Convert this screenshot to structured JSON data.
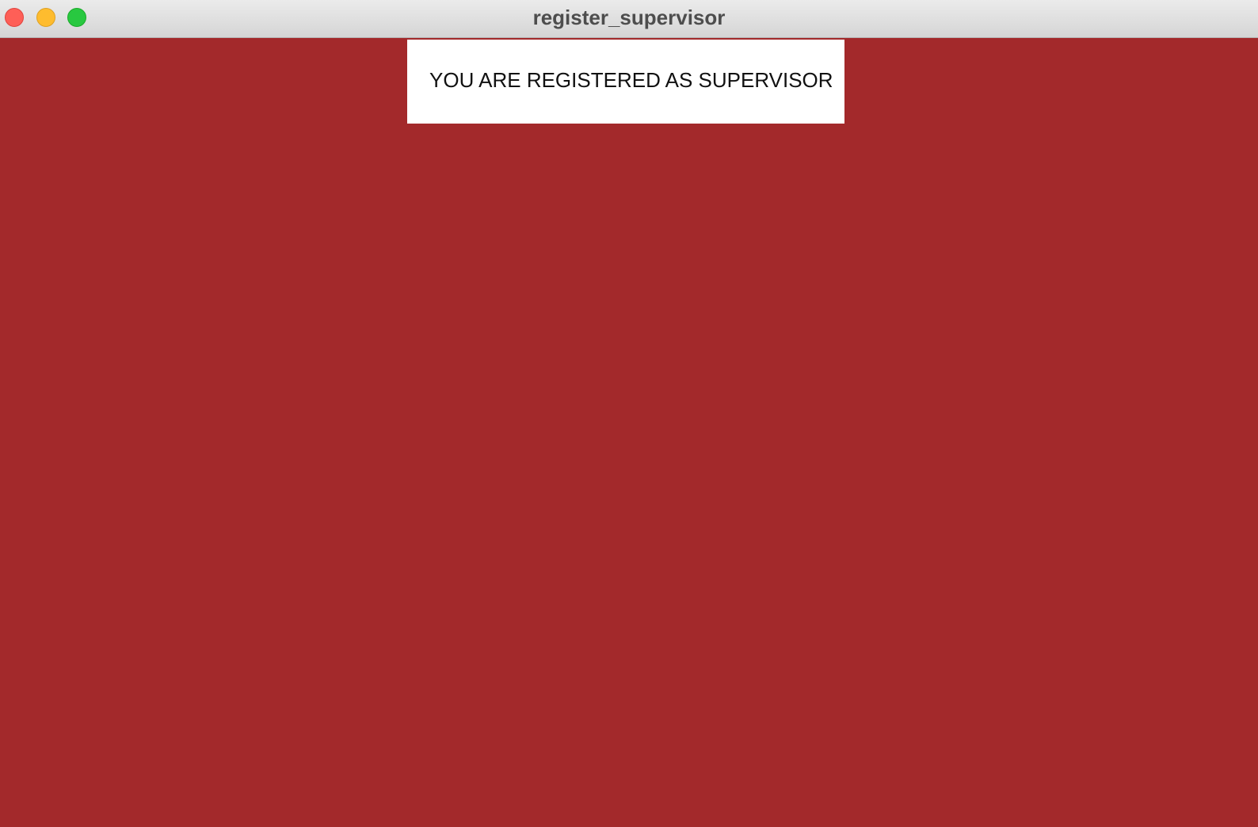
{
  "window": {
    "title": "register_supervisor",
    "controls": {
      "close_icon": "close-icon",
      "minimize_icon": "minimize-icon",
      "zoom_icon": "zoom-icon"
    }
  },
  "content": {
    "background_color": "#a3292b",
    "message": "YOU ARE REGISTERED AS SUPERVISOR"
  }
}
